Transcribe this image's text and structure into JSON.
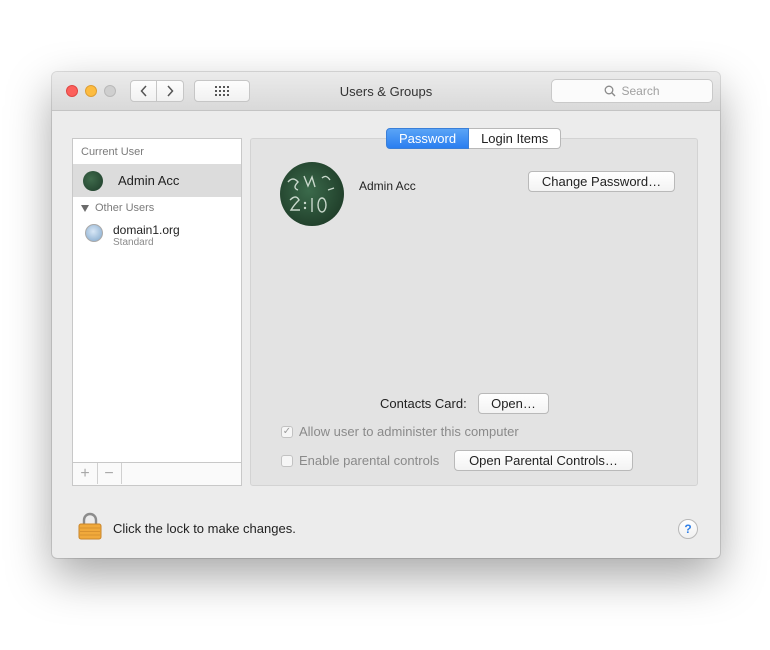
{
  "window": {
    "title": "Users & Groups",
    "search_placeholder": "Search"
  },
  "sidebar": {
    "current_user_header": "Current User",
    "current_user_name": "Admin Acc",
    "other_users_header": "Other Users",
    "other_users": [
      {
        "name": "domain1.org",
        "role": "Standard"
      }
    ],
    "add_symbol": "+",
    "remove_symbol": "−"
  },
  "tabs": [
    {
      "label": "Password",
      "active": true
    },
    {
      "label": "Login Items",
      "active": false
    }
  ],
  "profile": {
    "name": "Admin Acc",
    "change_password_label": "Change Password…"
  },
  "contacts": {
    "label": "Contacts Card:",
    "open_label": "Open…"
  },
  "options": {
    "allow_admin_label": "Allow user to administer this computer",
    "allow_admin_checked": true,
    "parental_label": "Enable parental controls",
    "parental_checked": false,
    "open_parental_label": "Open Parental Controls…"
  },
  "footer": {
    "lock_text": "Click the lock to make changes.",
    "help_symbol": "?"
  },
  "colors": {
    "accent": "#2a7ef0",
    "close": "#fc605c",
    "minimize": "#fdbc40"
  }
}
